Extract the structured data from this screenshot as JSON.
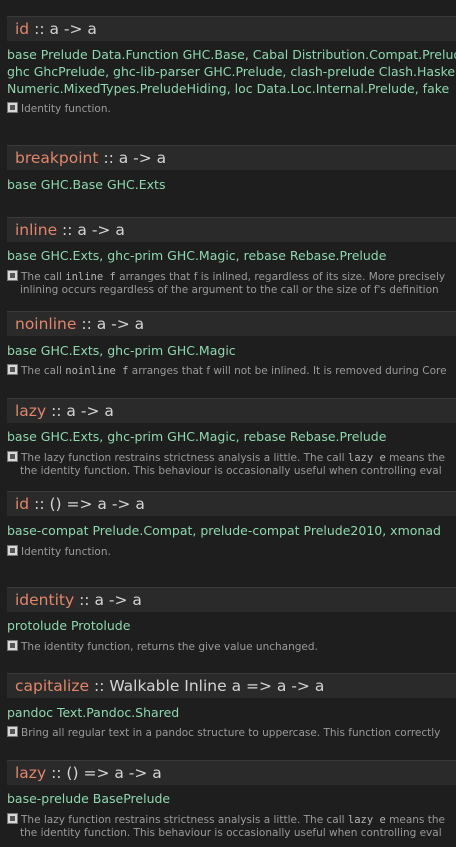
{
  "results": [
    {
      "name": "id",
      "type": ":: a -> a",
      "packages": [
        "base Prelude Data.Function GHC.Base, Cabal Distribution.Compat.Prelude",
        "ghc GhcPrelude, ghc-lib-parser GHC.Prelude, clash-prelude Clash.Haskell",
        "Numeric.MixedTypes.PreludeHiding, loc Data.Loc.Internal.Prelude, fake"
      ],
      "doc": [
        "Identity function."
      ]
    },
    {
      "name": "breakpoint",
      "type": ":: a -> a",
      "packages": [
        "base GHC.Base GHC.Exts"
      ],
      "doc": []
    },
    {
      "name": "inline",
      "type": ":: a -> a",
      "packages": [
        "base GHC.Exts, ghc-prim GHC.Magic, rebase Rebase.Prelude"
      ],
      "doc": [
        "The call inline f arranges that f is inlined, regardless of its size. More precisely",
        "inlining occurs regardless of the argument to the call or the size of f's definition"
      ]
    },
    {
      "name": "noinline",
      "type": ":: a -> a",
      "packages": [
        "base GHC.Exts, ghc-prim GHC.Magic"
      ],
      "doc": [
        "The call noinline f arranges that f will not be inlined. It is removed during Core"
      ]
    },
    {
      "name": "lazy",
      "type": ":: a -> a",
      "packages": [
        "base GHC.Exts, ghc-prim GHC.Magic, rebase Rebase.Prelude"
      ],
      "doc": [
        "The lazy function restrains strictness analysis a little. The call lazy e means the",
        "the identity function. This behaviour is occasionally useful when controlling eval"
      ]
    },
    {
      "name": "id",
      "type": ":: () => a -> a",
      "packages": [
        "base-compat Prelude.Compat, prelude-compat Prelude2010, xmonad"
      ],
      "doc": [
        "Identity function."
      ]
    },
    {
      "name": "identity",
      "type": ":: a -> a",
      "packages": [
        "protolude Protolude"
      ],
      "doc": [
        "The identity function, returns the give value unchanged."
      ]
    },
    {
      "name": "capitalize",
      "type": ":: Walkable Inline a => a -> a",
      "packages": [
        "pandoc Text.Pandoc.Shared"
      ],
      "doc": [
        "Bring all regular text in a pandoc structure to uppercase. This function correctly"
      ]
    },
    {
      "name": "lazy",
      "type": ":: () => a -> a",
      "packages": [
        "base-prelude BasePrelude"
      ],
      "doc": [
        "The lazy function restrains strictness analysis a little. The call lazy e means the",
        "the identity function. This behaviour is occasionally useful when controlling eval"
      ]
    }
  ]
}
